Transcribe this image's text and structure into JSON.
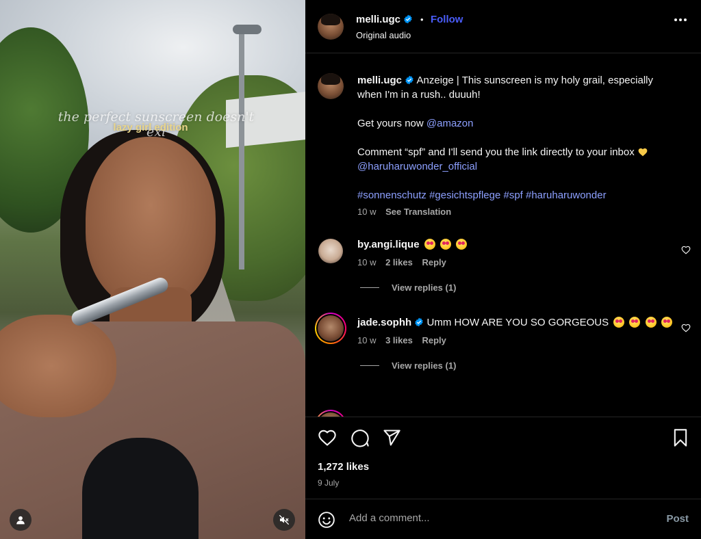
{
  "media": {
    "overlay_title": "the perfect sunscreen doesn't exi",
    "overlay_subtitle": "lazy girl edition",
    "user_icon": "user-icon",
    "mute_icon": "speaker-muted-icon"
  },
  "header": {
    "username": "melli.ugc",
    "separator": "•",
    "follow_label": "Follow",
    "audio_label": "Original audio",
    "more_icon": "more-horizontal-icon"
  },
  "caption": {
    "username": "melli.ugc",
    "line1": "Anzeige | This sunscreen is my holy grail, especially when I'm in a rush.. duuuh!",
    "line2_prefix": "Get yours now",
    "line2_mention": "@amazon",
    "line3": "Comment “spf” and I'll send you the link directly to your inbox",
    "line3_mention": "@haruharuwonder_official",
    "hashtags": "#sonnenschutz #gesichtspflege #spf #haruharuwonder",
    "time": "10 w",
    "see_translation": "See Translation"
  },
  "comments": [
    {
      "username": "by.angi.lique",
      "text": "",
      "time": "10 w",
      "likes": "2 likes",
      "reply_label": "Reply",
      "view_replies": "View replies (1)"
    },
    {
      "username": "jade.sophh",
      "text": "Umm HOW ARE YOU SO GORGEOUS",
      "time": "10 w",
      "likes": "3 likes",
      "reply_label": "Reply",
      "view_replies": "View replies (1)"
    }
  ],
  "actions": {
    "like_icon": "heart-icon",
    "comment_icon": "comment-icon",
    "share_icon": "share-icon",
    "save_icon": "bookmark-icon",
    "likes_count": "1,272 likes",
    "date": "9 July"
  },
  "comment_bar": {
    "emoji_icon": "emoji-icon",
    "placeholder": "Add a comment...",
    "post_label": "Post"
  },
  "colors": {
    "background": "#000000",
    "accent": "#4a5df9",
    "link": "#8da0ff",
    "muted_text": "#a8a8a8",
    "divider": "#262626"
  }
}
